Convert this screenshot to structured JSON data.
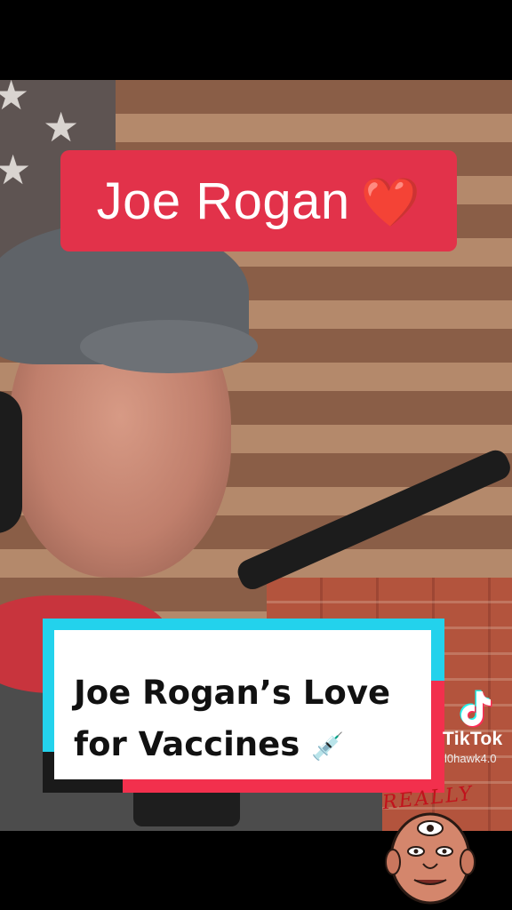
{
  "video": {
    "title_overlay": "Joe Rogan",
    "title_emoji": "❤️",
    "caption_line1": "Joe Rogan’s Love",
    "caption_line2": "for Vaccines",
    "caption_emoji": "💉"
  },
  "watermark": {
    "brand": "TikTok",
    "handle": "l0hawk4.0"
  },
  "sticker": {
    "text": "REALLY"
  },
  "colors": {
    "title_bg": "#e2324a",
    "caption_cyan": "#23d2ec",
    "caption_pink": "#f2304d",
    "background": "#000000"
  },
  "icons": [
    "tiktok-logo-icon",
    "heart-icon",
    "syringe-icon",
    "star-icon"
  ]
}
